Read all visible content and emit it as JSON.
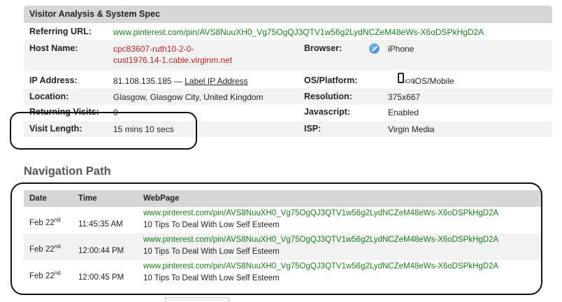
{
  "spec": {
    "title": "Visitor Analysis & System Spec",
    "referring_url_label": "Referring URL:",
    "referring_url_value": "www.pinterest.com/pin/AVS8NuuXH0_Vg75OgQJ3QTV1w56g2LydNCZeM48eWs-X6oDSPkHgD2A",
    "host_name_label": "Host Name:",
    "host_name_line1": "cpc83607-ruth10-2-0-",
    "host_name_line2": "cust1976.14-1.cable.virginm.net",
    "browser_label": "Browser:",
    "browser_value": "iPhone",
    "ip_label": "IP Address:",
    "ip_value": "81.108.135.185 —",
    "ip_link": "Label IP Address",
    "os_label": "OS/Platform:",
    "os_small": "iOS",
    "os_value": "iOS/Mobile",
    "location_label": "Location:",
    "location_value": "Glasgow, Glasgow City, United Kingdom",
    "resolution_label": "Resolution:",
    "resolution_value": "375x667",
    "returning_label": "Returning Visits:",
    "returning_value": "0",
    "javascript_label": "Javascript:",
    "javascript_value": "Enabled",
    "visit_length_label": "Visit Length:",
    "visit_length_value": "15 mins 10 secs",
    "isp_label": "ISP:",
    "isp_value": "Virgin Media"
  },
  "nav": {
    "title": "Navigation Path",
    "columns": {
      "date": "Date",
      "time": "Time",
      "webpage": "WebPage"
    },
    "rows": [
      {
        "date": "Feb 22",
        "date_suffix": "nd",
        "time": "11:45:35 AM",
        "url": "www.pinterest.com/pin/AVS8NuuXH0_Vg75OgQJ3QTV1w56g2LydNCZeM48eWs-X6oDSPkHgD2A",
        "page_title": "10 Tips To Deal With Low Self Esteem"
      },
      {
        "date": "Feb 22",
        "date_suffix": "nd",
        "time": "12:00:44 PM",
        "url": "www.pinterest.com/pin/AVS8NuuXH0_Vg75OgQJ3QTV1w56g2LydNCZeM48eWs-X6oDSPkHgD2A",
        "page_title": "10 Tips To Deal With Low Self Esteem"
      },
      {
        "date": "Feb 22",
        "date_suffix": "nd",
        "time": "12:00:45 PM",
        "url": "www.pinterest.com/pin/AVS8NuuXH0_Vg75OgQJ3QTV1w56g2LydNCZeM48eWs-X6oDSPkHgD2A",
        "page_title": "10 Tips To Deal With Low Self Esteem"
      }
    ]
  },
  "icons": {
    "browser": "safari-compass-icon",
    "platform": "iphone-icon"
  }
}
